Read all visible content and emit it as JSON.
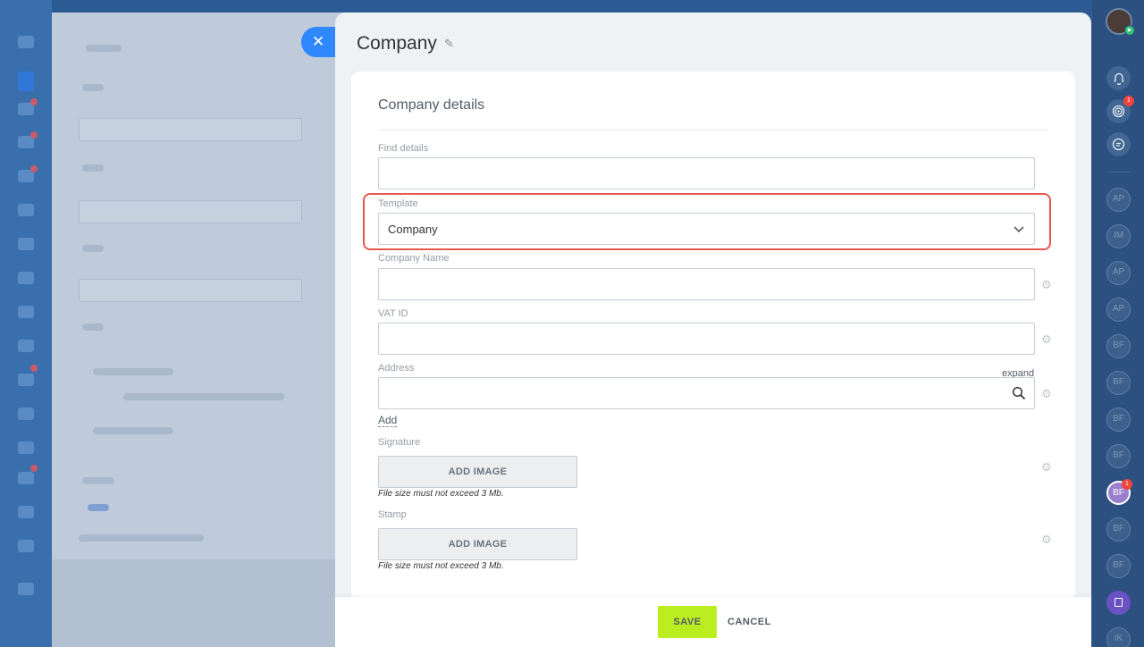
{
  "slider": {
    "title": "Company",
    "close_icon": "close-icon",
    "edit_icon": "pencil-icon"
  },
  "form": {
    "section_title": "Company details",
    "find_details_label": "Find details",
    "find_details_value": "",
    "template_label": "Template",
    "template_value": "Company",
    "company_name_label": "Company Name",
    "company_name_value": "",
    "vat_label": "VAT ID",
    "vat_value": "",
    "address_label": "Address",
    "address_expand": "expand",
    "address_value": "",
    "add_link": "Add",
    "signature_label": "Signature",
    "signature_button": "ADD IMAGE",
    "signature_hint": "File size must not exceed 3 Mb.",
    "stamp_label": "Stamp",
    "stamp_button": "ADD IMAGE",
    "stamp_hint": "File size must not exceed 3 Mb."
  },
  "footer": {
    "save_label": "SAVE",
    "cancel_label": "CANCEL"
  },
  "right_sidebar": {
    "notifications_badge": "",
    "activity_badge": "1",
    "chats": [
      "AP",
      "IM",
      "AP",
      "AP",
      "BF",
      "BF",
      "BF",
      "BF",
      "BF",
      "BF",
      "BF",
      "",
      "IK"
    ],
    "active_chat_badge": "1"
  },
  "colors": {
    "accent_blue": "#2f88ff",
    "save_green": "#bbed21",
    "highlight_red": "#e5584f",
    "badge_red": "#f0453b"
  }
}
